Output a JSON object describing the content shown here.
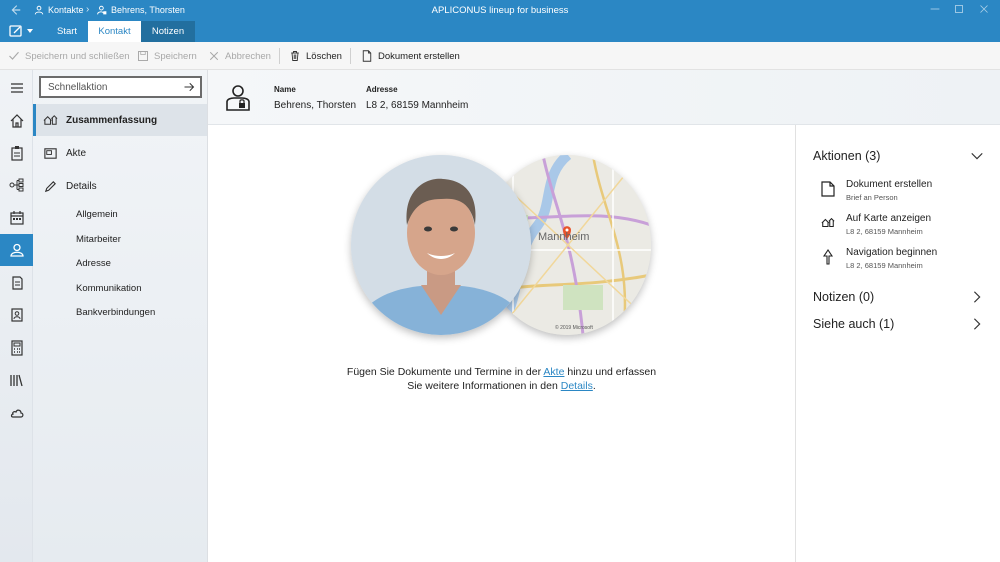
{
  "titlebar": {
    "breadcrumb": [
      "Kontakte",
      "Behrens, Thorsten"
    ],
    "app_title": "APLICONUS lineup for business"
  },
  "ribbon_tabs": [
    "Start",
    "Kontakt",
    "Notizen"
  ],
  "toolbar": {
    "save_close": "Speichern und schließen",
    "save": "Speichern",
    "cancel": "Abbrechen",
    "delete": "Löschen",
    "create_doc": "Dokument erstellen"
  },
  "nav": {
    "quick_placeholder": "Schnellaktion",
    "items": [
      "Zusammenfassung",
      "Akte",
      "Details"
    ],
    "sub_items": [
      "Allgemein",
      "Mitarbeiter",
      "Adresse",
      "Kommunikation",
      "Bankverbindungen"
    ]
  },
  "header": {
    "name_label": "Name",
    "name_value": "Behrens, Thorsten",
    "address_label": "Adresse",
    "address_value": "L8 2, 68159 Mannheim"
  },
  "main": {
    "map_city": "Mannheim",
    "map_copyright": "© 2019 Microsoft",
    "msg_part1": "Fügen Sie Dokumente und Termine in der ",
    "msg_link1": "Akte",
    "msg_part2": " hinzu und erfassen",
    "msg_part3": "Sie weitere Informationen in den ",
    "msg_link2": "Details",
    "msg_part4": "."
  },
  "side": {
    "actions_title": "Aktionen (3)",
    "actions": [
      {
        "title": "Dokument erstellen",
        "sub": "Brief an Person"
      },
      {
        "title": "Auf Karte anzeigen",
        "sub": "L8 2, 68159 Mannheim"
      },
      {
        "title": "Navigation beginnen",
        "sub": "L8 2, 68159 Mannheim"
      }
    ],
    "notes_title": "Notizen (0)",
    "see_also_title": "Siehe auch (1)"
  },
  "colors": {
    "accent": "#2b87c4"
  }
}
